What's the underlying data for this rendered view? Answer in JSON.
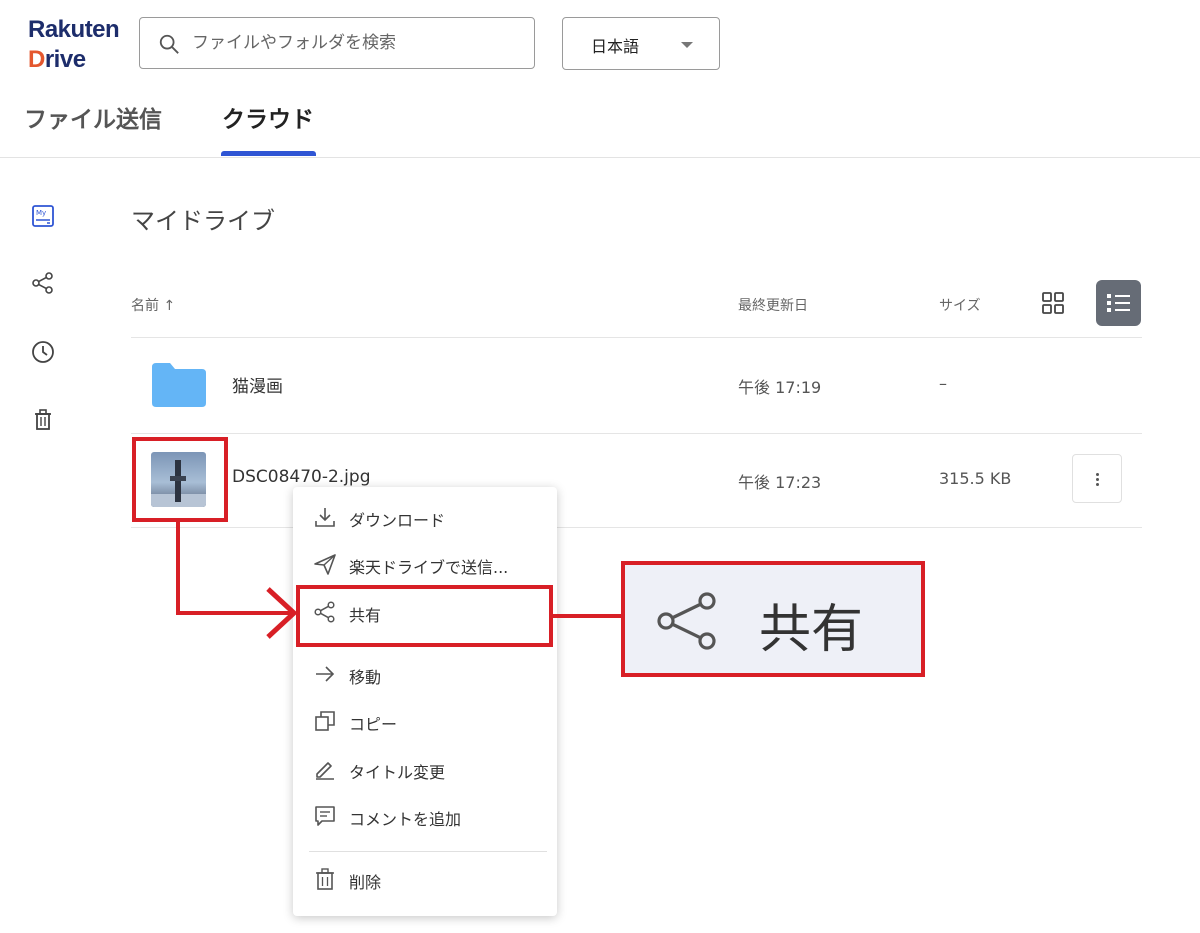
{
  "logo": {
    "line1": "Rakuten",
    "line2_d": "D",
    "line2_rest": "rive"
  },
  "search": {
    "placeholder": "ファイルやフォルダを検索",
    "icon": "search-icon"
  },
  "language": {
    "selected": "日本語"
  },
  "tabs": [
    {
      "label": "ファイル送信",
      "active": false
    },
    {
      "label": "クラウド",
      "active": true
    }
  ],
  "sidebar": {
    "items": [
      {
        "icon": "my-drive-icon",
        "active": true
      },
      {
        "icon": "share-icon",
        "active": false
      },
      {
        "icon": "clock-icon",
        "active": false
      },
      {
        "icon": "trash-icon",
        "active": false
      }
    ]
  },
  "main": {
    "title": "マイドライブ",
    "columns": {
      "name": "名前 ↑",
      "modified": "最終更新日",
      "size": "サイズ"
    },
    "rows": [
      {
        "name": "猫漫画",
        "modified": "午後 17:19",
        "size": "–",
        "type": "folder"
      },
      {
        "name": "DSC08470-2.jpg",
        "modified": "午後 17:23",
        "size": "315.5 KB",
        "type": "image"
      }
    ]
  },
  "context_menu": {
    "items": [
      {
        "label": "ダウンロード",
        "icon": "download-icon"
      },
      {
        "label": "楽天ドライブで送信...",
        "icon": "send-icon"
      },
      {
        "label": "共有",
        "icon": "share-icon"
      },
      {
        "label": "移動",
        "icon": "arrow-right-icon"
      },
      {
        "label": "コピー",
        "icon": "copy-icon"
      },
      {
        "label": "タイトル変更",
        "icon": "pencil-icon"
      },
      {
        "label": "コメントを追加",
        "icon": "comment-icon"
      },
      {
        "label": "削除",
        "icon": "trash-icon"
      }
    ]
  },
  "zoom_callout": {
    "label": "共有",
    "icon": "share-icon"
  },
  "colors": {
    "accent": "#2f55d4",
    "annotation": "#d81f26",
    "folder": "#64b5f6",
    "view_active": "#666c76"
  }
}
